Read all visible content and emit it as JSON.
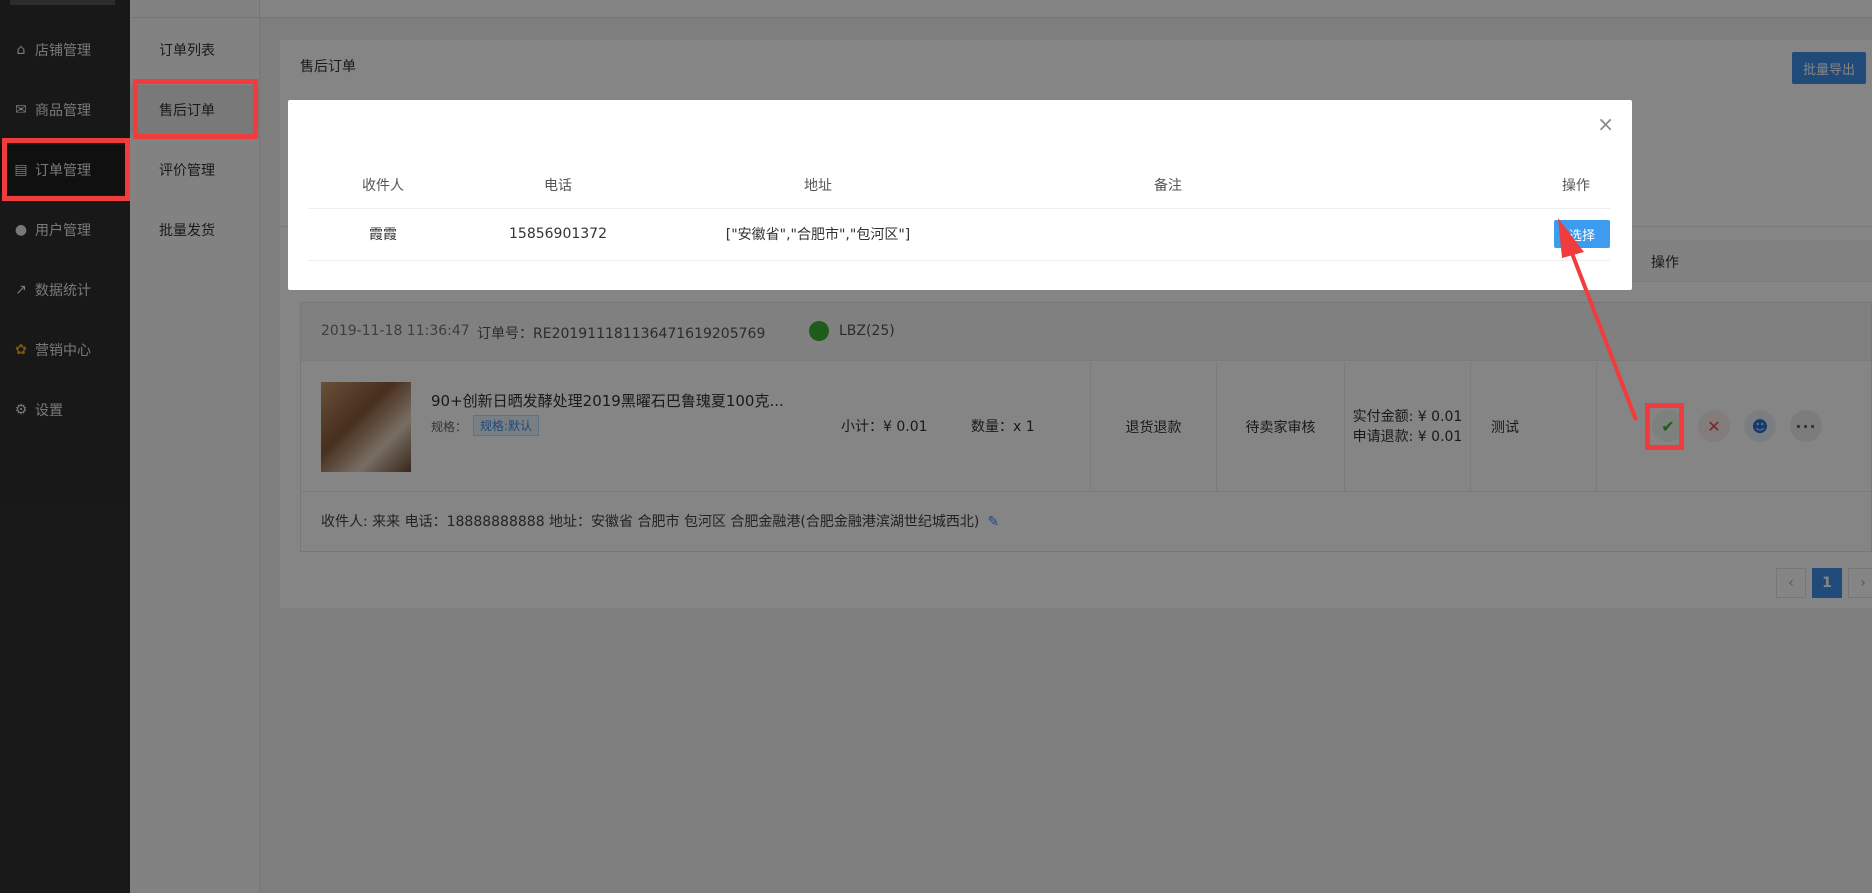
{
  "sidebar": {
    "items": [
      {
        "label": "店铺管理",
        "icon": "store-icon"
      },
      {
        "label": "商品管理",
        "icon": "goods-icon"
      },
      {
        "label": "订单管理",
        "icon": "order-icon"
      },
      {
        "label": "用户管理",
        "icon": "user-icon"
      },
      {
        "label": "数据统计",
        "icon": "chart-icon"
      },
      {
        "label": "营销中心",
        "icon": "marketing-icon"
      },
      {
        "label": "设置",
        "icon": "gear-icon"
      }
    ]
  },
  "subnav": {
    "items": [
      {
        "label": "订单列表"
      },
      {
        "label": "售后订单"
      },
      {
        "label": "评价管理"
      },
      {
        "label": "批量发货"
      }
    ]
  },
  "panel": {
    "title": "售后订单",
    "export_label": "批量导出",
    "op_header": "操作"
  },
  "order": {
    "date": "2019-11-18 11:36:47",
    "order_no": "订单号：RE2019111811364716192057​69",
    "user": "LBZ(25)",
    "product_name": "90+创新日晒发酵处理2019黑曜石巴鲁瑰夏100克...",
    "spec_label": "规格：",
    "spec_value": "规格:默认",
    "subtotal": "小计：¥ 0.01",
    "quantity": "数量：x 1",
    "type": "退货退款",
    "status": "待卖家审核",
    "paid": "实付金额: ¥ 0.01",
    "refund": "申请退款: ¥ 0.01",
    "remark": "测试",
    "footer": "收件人: 来来 电话：18888888888 地址：安徽省 合肥市 包河区 合肥金融港(合肥金融港滨湖世纪城西北)"
  },
  "pager": {
    "prev": "‹",
    "current": "1",
    "next": "›"
  },
  "modal": {
    "headers": {
      "receiver": "收件人",
      "phone": "电话",
      "address": "地址",
      "note": "备注",
      "op": "操作"
    },
    "row": {
      "receiver": "霞霞",
      "phone": "15856901372",
      "address": "[\"安徽省\",\"合肥市\",\"包河区\"]",
      "note": "",
      "op_label": "选择"
    },
    "close": "×"
  },
  "colors": {
    "accent": "#3d8ee8",
    "highlight": "#f03c3c",
    "sidebar": "#2f2f2f"
  }
}
